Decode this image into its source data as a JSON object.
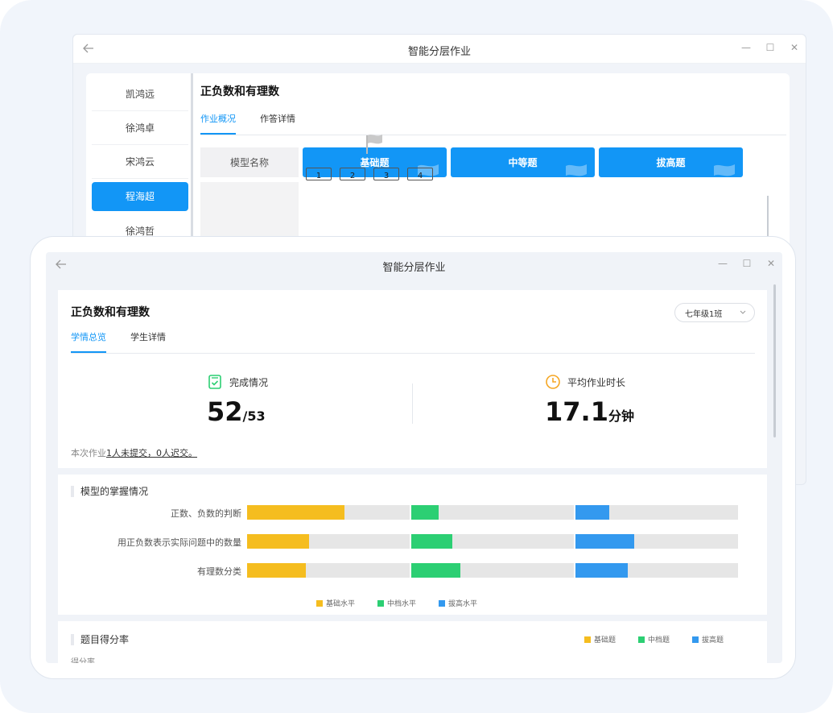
{
  "colors": {
    "primary": "#1296f6",
    "basic": "#f5bd1f",
    "medium": "#2ccf73",
    "advanced": "#3399ef",
    "track": "#e6e6e6"
  },
  "back_window": {
    "title": "智能分层作业",
    "students": [
      "凯鸿远",
      "徐鸿卓",
      "宋鸿云",
      "程海超",
      "徐鸿哲"
    ],
    "active_student_index": 3,
    "homework_title": "正负数和有理数",
    "tabs": [
      "作业概况",
      "作答详情"
    ],
    "model_name_header": "模型名称",
    "levels": [
      "基础题",
      "中等题",
      "拔高题"
    ],
    "question_numbers": [
      "1",
      "2",
      "3",
      "4"
    ]
  },
  "front_window": {
    "title": "智能分层作业",
    "homework_title": "正负数和有理数",
    "class_select": "七年级1班",
    "tabs": [
      "学情总览",
      "学生详情"
    ],
    "completion": {
      "label": "完成情况",
      "done": "52",
      "total": "/53"
    },
    "avg_time": {
      "label": "平均作业时长",
      "value": "17.1",
      "unit": "分钟"
    },
    "note_prefix": "本次作业",
    "note_link": "1人未提交，0人迟交。",
    "mastery": {
      "title": "模型的掌握情况",
      "rows": [
        {
          "label": "正数、负数的判断",
          "basic": 0.6,
          "medium": 0.17,
          "advanced": 0.21
        },
        {
          "label": "用正负数表示实际问题中的数量",
          "basic": 0.38,
          "medium": 0.25,
          "advanced": 0.36
        },
        {
          "label": "有理数分类",
          "basic": 0.36,
          "medium": 0.3,
          "advanced": 0.32
        }
      ],
      "legend": [
        "基础水平",
        "中档水平",
        "拔高水平"
      ]
    },
    "score_rate": {
      "title": "题目得分率",
      "legend": [
        "基础题",
        "中档题",
        "拔高题"
      ],
      "subtitle": "得分率"
    }
  }
}
